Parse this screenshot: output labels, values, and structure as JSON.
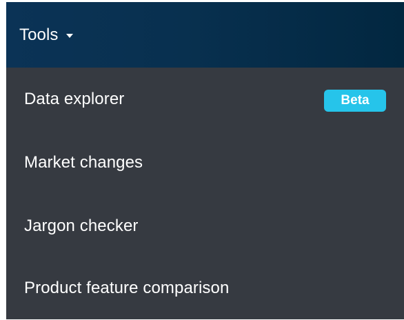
{
  "header": {
    "title": "Tools",
    "caret_icon": "caret-down-icon"
  },
  "menu": {
    "items": [
      {
        "label": "Data explorer",
        "badge": "Beta"
      },
      {
        "label": "Market changes"
      },
      {
        "label": "Jargon checker"
      },
      {
        "label": "Product feature comparison"
      }
    ]
  },
  "colors": {
    "header_bg": "#0b3356",
    "menu_bg": "#363a41",
    "badge_bg": "#26c4ea",
    "text": "#ffffff"
  }
}
